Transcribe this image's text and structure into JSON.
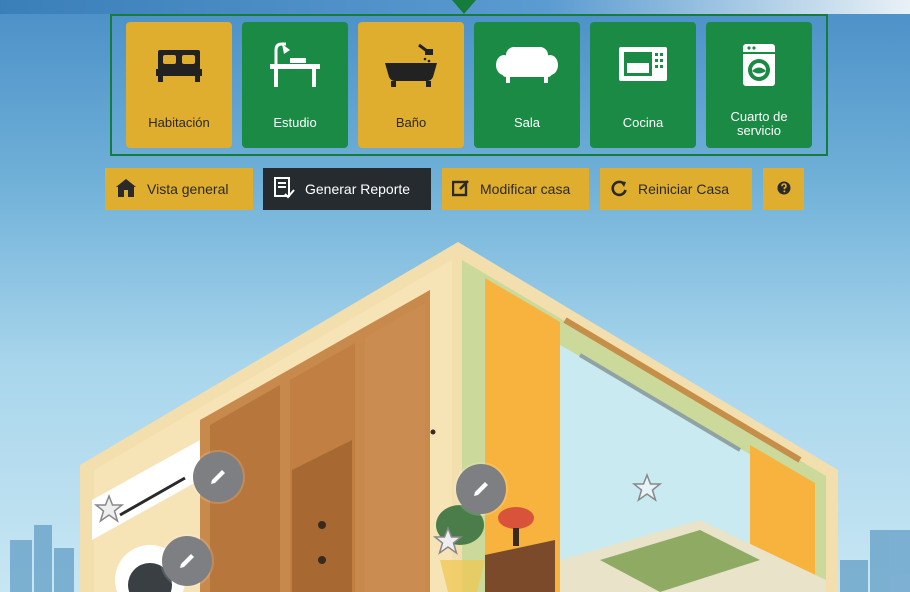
{
  "rooms": [
    {
      "label": "Habitación",
      "icon": "bed-icon",
      "style": "yellow"
    },
    {
      "label": "Estudio",
      "icon": "desk-lamp-icon",
      "style": "green"
    },
    {
      "label": "Baño",
      "icon": "bathtub-icon",
      "style": "yellow"
    },
    {
      "label": "Sala",
      "icon": "sofa-icon",
      "style": "green"
    },
    {
      "label": "Cocina",
      "icon": "microwave-icon",
      "style": "green"
    },
    {
      "label": "Cuarto de servicio",
      "label_line1": "Cuarto de",
      "label_line2": "servicio",
      "icon": "washing-machine-icon",
      "style": "green"
    }
  ],
  "toolbar": {
    "overview_label": "Vista general",
    "report_label": "Generar Reporte",
    "modify_label": "Modificar casa",
    "reset_label": "Reiniciar Casa",
    "help_icon": "question-icon"
  },
  "colors": {
    "accent_yellow": "#e0ae2e",
    "accent_green": "#1a8a45",
    "dark": "#262b30"
  }
}
